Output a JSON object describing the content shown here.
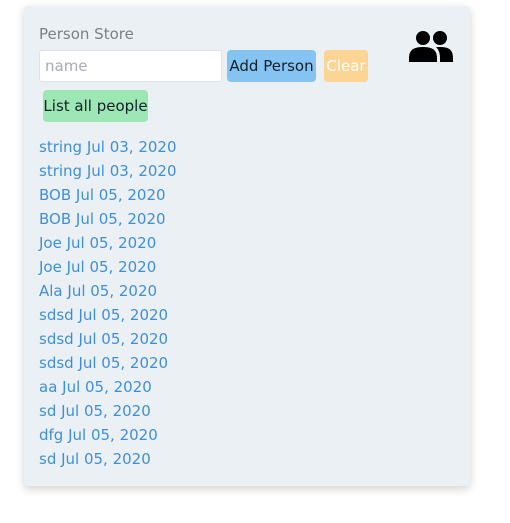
{
  "app": {
    "title": "Person Store",
    "header_icon": "people-icon"
  },
  "form": {
    "name_placeholder": "name",
    "name_value": "",
    "add_label": "Add Person",
    "clear_label": "Clear",
    "list_all_label": "List all people"
  },
  "colors": {
    "card_background": "#ebf0f5",
    "add_button": "#85c4f2",
    "clear_button": "#fcd493",
    "list_button": "#9de7b4",
    "link_text": "#3f8fd6"
  },
  "people": [
    "string Jul 03, 2020",
    "string Jul 03, 2020",
    "BOB Jul 05, 2020",
    "BOB Jul 05, 2020",
    "Joe Jul 05, 2020",
    "Joe Jul 05, 2020",
    "Ala Jul 05, 2020",
    "sdsd Jul 05, 2020",
    "sdsd Jul 05, 2020",
    "sdsd Jul 05, 2020",
    "aa Jul 05, 2020",
    "sd Jul 05, 2020",
    "dfg Jul 05, 2020",
    "sd Jul 05, 2020"
  ]
}
